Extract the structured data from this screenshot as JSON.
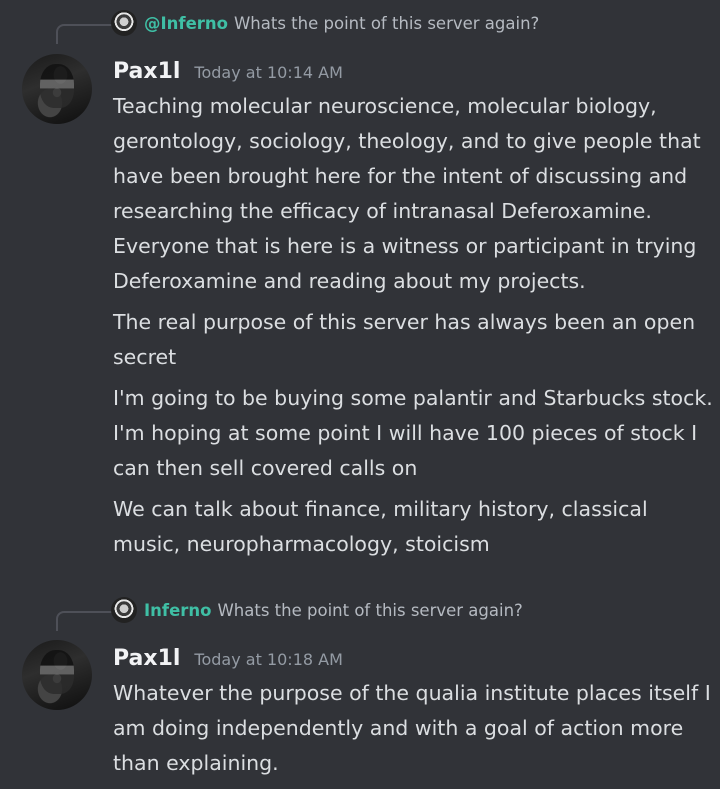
{
  "messages": [
    {
      "reply": {
        "name": "@Inferno",
        "text": "Whats the point of this server again?"
      },
      "author": "Pax1l",
      "timestamp": "Today at 10:14 AM",
      "paragraphs": [
        "Teaching molecular neuroscience, molecular biology, gerontology, sociology, theology, and to give people that have been brought here for the intent of discussing and researching the efficacy of intranasal Deferoxamine. Everyone that is here is a witness or participant in trying Deferoxamine and reading about my projects.",
        "The real purpose of this server has always been an open secret",
        "I'm going to be buying some palantir and Starbucks stock. I'm hoping at some point I will have 100 pieces of stock I can then sell covered calls on",
        "We can talk about finance, military history, classical music, neuropharmacology, stoicism"
      ]
    },
    {
      "reply": {
        "name": "Inferno",
        "text": "Whats the point of this server again?"
      },
      "author": "Pax1l",
      "timestamp": "Today at 10:18 AM",
      "paragraphs": [
        "Whatever the purpose of the qualia institute places itself I am doing independently and with a goal of action more than explaining."
      ]
    }
  ]
}
